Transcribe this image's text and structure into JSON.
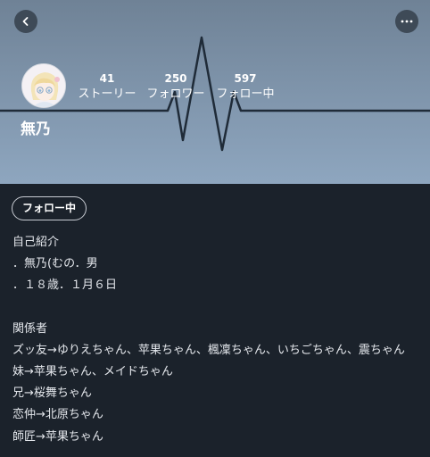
{
  "header": {
    "back_icon": "chevron-left-icon",
    "more_icon": "ellipsis-icon"
  },
  "profile": {
    "display_name": "無乃",
    "avatar": "avatar-illustration"
  },
  "stats": {
    "stories": {
      "value": "41",
      "label": "ストーリー"
    },
    "followers": {
      "value": "250",
      "label": "フォロワー"
    },
    "following": {
      "value": "597",
      "label": "フォロー中"
    }
  },
  "actions": {
    "follow_button": "フォロー中"
  },
  "bio": {
    "lines_top": [
      "自己紹介",
      "．無乃(むの．男",
      "．１８歳．１月６日"
    ],
    "lines_bottom": [
      "関係者",
      "ズッ友→ゆりえちゃん、苹果ちゃん、楓凜ちゃん、いちごちゃん、震ちゃん",
      "妹→苹果ちゃん、メイドちゃん",
      "兄→桜舞ちゃん",
      "恋仲→北原ちゃん",
      "師匠→苹果ちゃん"
    ]
  },
  "colors": {
    "header_gradient_top": "#6f8296",
    "header_gradient_bottom": "#8ea6bf",
    "ecg_line": "#1f2b38",
    "content_bg": "#1b222b",
    "text": "#e4e7ec"
  }
}
